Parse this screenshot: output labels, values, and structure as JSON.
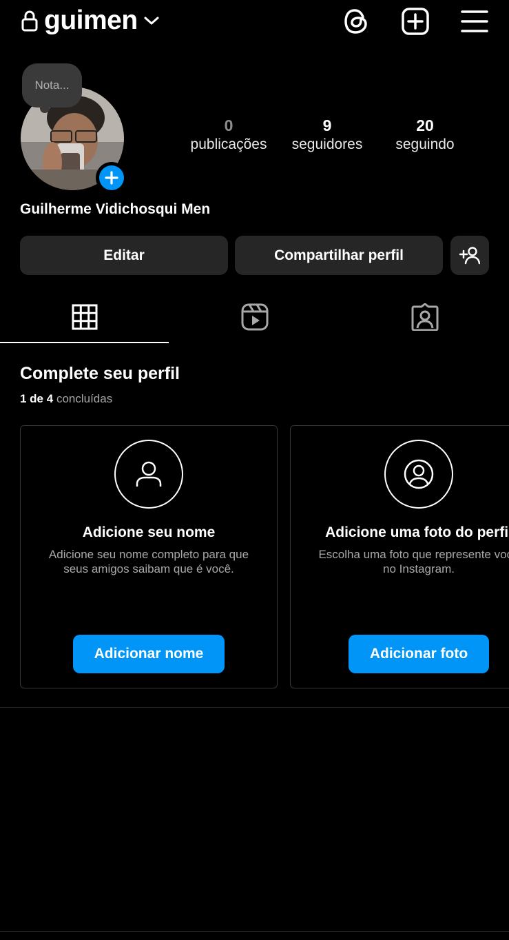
{
  "header": {
    "username": "guimen",
    "icons": [
      "lock-icon",
      "chevron-down-icon",
      "threads-icon",
      "new-post-icon",
      "menu-icon"
    ]
  },
  "profile": {
    "note_placeholder": "Nota...",
    "full_name": "Guilherme Vidichosqui Men",
    "stats": [
      {
        "value": "0",
        "label": "publicações"
      },
      {
        "value": "9",
        "label": "seguidores"
      },
      {
        "value": "20",
        "label": "seguindo"
      }
    ]
  },
  "actions": {
    "edit": "Editar",
    "share": "Compartilhar perfil"
  },
  "tabs": [
    "grid-icon",
    "reels-icon",
    "tagged-icon"
  ],
  "complete_profile": {
    "title": "Complete seu perfil",
    "progress_done": "1 de 4",
    "progress_suffix": "concluídas",
    "cards": [
      {
        "icon": "person-icon",
        "title": "Adicione seu nome",
        "desc_line1": "Adicione seu nome completo para que",
        "desc_line2": "seus amigos saibam que é você.",
        "button": "Adicionar nome"
      },
      {
        "icon": "profile-photo-icon",
        "title": "Adicione uma foto do perfil",
        "desc_line1": "Escolha uma foto que represente você",
        "desc_line2": "no Instagram.",
        "button": "Adicionar foto"
      }
    ]
  },
  "colors": {
    "background": "#000000",
    "button_dark": "#262626",
    "accent_blue": "#0095f6",
    "secondary_text": "#a8a8a8"
  }
}
